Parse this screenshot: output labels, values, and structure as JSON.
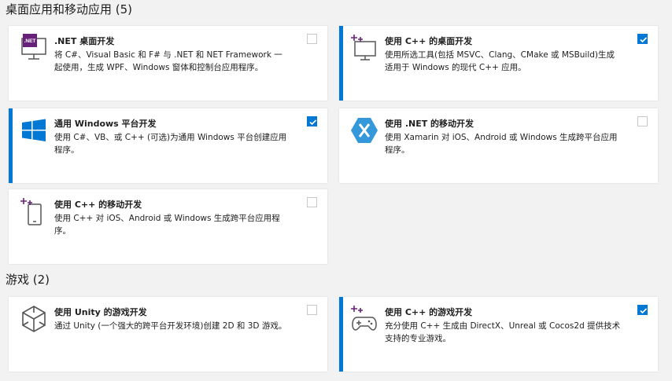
{
  "sections": [
    {
      "title": "桌面应用和移动应用 (5)"
    },
    {
      "title": "游戏 (2)"
    }
  ],
  "workloads": {
    "dotnet_desktop": {
      "icon": "dotnet-desktop-icon",
      "badge": ".NET",
      "title": ".NET 桌面开发",
      "desc": "将 C#、Visual Basic 和 F# 与 .NET 和 NET Framework 一起使用，生成 WPF、Windows 窗体和控制台应用程序。",
      "checked": false
    },
    "cpp_desktop": {
      "icon": "cpp-desktop-icon",
      "title": "使用 C++ 的桌面开发",
      "desc": "使用所选工具(包括 MSVC、Clang、CMake 或 MSBuild)生成适用于 Windows 的现代 C++ 应用。",
      "checked": true
    },
    "uwp": {
      "icon": "windows-logo-icon",
      "title": "通用 Windows 平台开发",
      "desc": "使用 C#、VB、或 C++ (可选)为通用 Windows 平台创建应用程序。",
      "checked": true
    },
    "dotnet_mobile": {
      "icon": "xamarin-icon",
      "title": "使用 .NET 的移动开发",
      "desc": "使用 Xamarin 对 iOS、Android 或 Windows 生成跨平台应用程序。",
      "checked": false
    },
    "cpp_mobile": {
      "icon": "cpp-mobile-icon",
      "title": "使用 C++ 的移动开发",
      "desc": "使用 C++ 对 iOS、Android 或 Windows 生成跨平台应用程序。",
      "checked": false
    },
    "unity": {
      "icon": "unity-icon",
      "title": "使用 Unity 的游戏开发",
      "desc": "通过 Unity (一个强大的跨平台开发环境)创建 2D 和 3D 游戏。",
      "checked": false
    },
    "cpp_game": {
      "icon": "gamepad-icon",
      "title": "使用 C++ 的游戏开发",
      "desc": "充分使用 C++ 生成由 DirectX、Unreal 或 Cocos2d 提供技术支持的专业游戏。",
      "checked": true
    }
  },
  "colors": {
    "accent": "#0078d4",
    "dotnet_purple": "#68217a",
    "xamarin_blue": "#3498db",
    "cpp_plus": "#68217a",
    "icon_gray": "#555555"
  }
}
